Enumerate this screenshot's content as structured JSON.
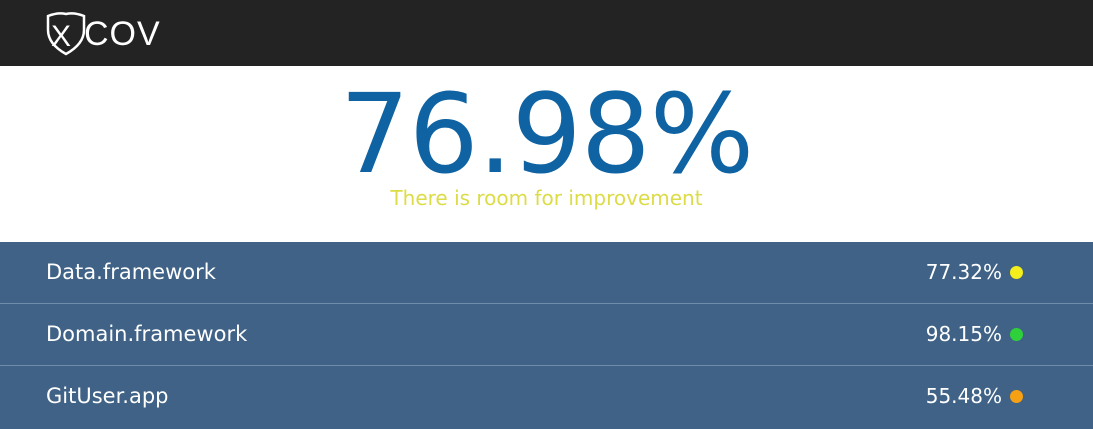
{
  "header": {
    "logo_text": "COV",
    "logo_mark_text": "X"
  },
  "summary": {
    "total_coverage": "76.98%",
    "message": "There is room for improvement",
    "coverage_color": "#0f63a3",
    "message_color": "#dcdc47"
  },
  "targets": [
    {
      "name": "Data.framework",
      "coverage": "77.32%",
      "status_color": "#f3ee1c",
      "status_icon": "yellow-status-dot-icon"
    },
    {
      "name": "Domain.framework",
      "coverage": "98.15%",
      "status_color": "#2fd13b",
      "status_icon": "green-status-dot-icon"
    },
    {
      "name": "GitUser.app",
      "coverage": "55.48%",
      "status_color": "#f5a113",
      "status_icon": "orange-status-dot-icon"
    }
  ]
}
